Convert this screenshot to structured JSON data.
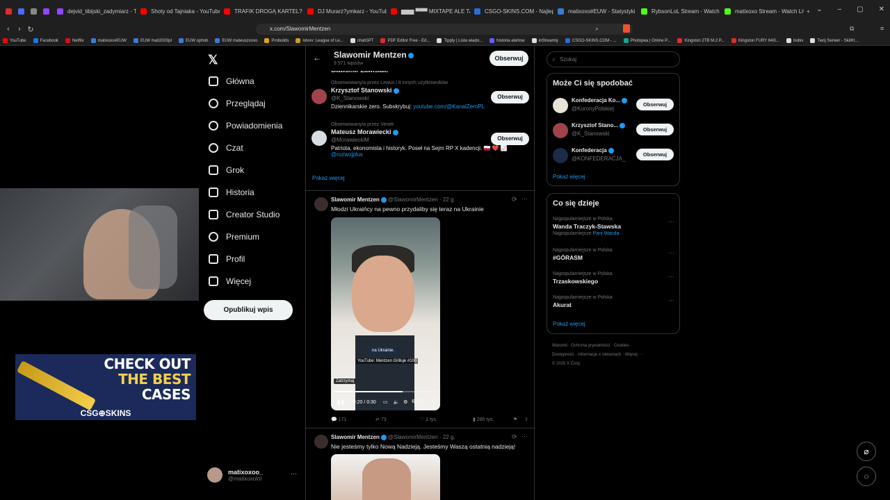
{
  "browser": {
    "tabs": [
      {
        "label": "",
        "color": "#e02b2b"
      },
      {
        "label": "",
        "color": "#4b6bfb"
      },
      {
        "label": "",
        "color": "#888888"
      },
      {
        "label": "",
        "color": "#9146ff"
      },
      {
        "label": "dejvid_tibijski_zadymiarz - Twitch",
        "color": "#9146ff"
      },
      {
        "label": "Shoty od Tajniaka - YouTube",
        "color": "#ff0000"
      },
      {
        "label": "TRAFIK DROGĄ KARTEL? | POWRÓT ...",
        "color": "#ff0000"
      },
      {
        "label": "DJ Murarz?ymkarz - YouTube",
        "color": "#ff0000"
      },
      {
        "label": "▆▆▆ ▀▀▀ MIXTAPE ALE TAJN...",
        "color": "#ff0000"
      },
      {
        "label": "CSGO-SKINS.COM - Najlepsze Skrz...",
        "color": "#2b6cde"
      },
      {
        "label": "matixoxo#EUW - Statystyki przyw...",
        "color": "#3b7bd8"
      },
      {
        "label": "RybsonLoL Stream - Watch Live on ...",
        "color": "#53fc18"
      },
      {
        "label": "matixoxo Stream - Watch Live on ...",
        "color": "#53fc18"
      }
    ],
    "url": "x.com/SlawomirMentzen",
    "bookmarks": [
      {
        "label": "YouTube",
        "color": "#ff0000"
      },
      {
        "label": "Facebook",
        "color": "#1877f2"
      },
      {
        "label": "Netflix",
        "color": "#e50914"
      },
      {
        "label": "matixoxo#EUW",
        "color": "#3b7bd8"
      },
      {
        "label": "EUW mati2003pl",
        "color": "#3b7bd8"
      },
      {
        "label": "EUW ophob",
        "color": "#3b7bd8"
      },
      {
        "label": "EUW mateuszxoxo",
        "color": "#3b7bd8"
      },
      {
        "label": "Probuilds",
        "color": "#e0a020"
      },
      {
        "label": "lolvvv: League of Le...",
        "color": "#c8a020"
      },
      {
        "label": "chatGPT",
        "color": "#dddddd"
      },
      {
        "label": "PDF Editor Free - Ed...",
        "color": "#e02b2b"
      },
      {
        "label": "Tipply | Lista wiado...",
        "color": "#dddddd"
      },
      {
        "label": "historia alertow",
        "color": "#6a5cff"
      },
      {
        "label": "inStreamly",
        "color": "#dddddd"
      },
      {
        "label": "CSGO-SKINS.COM - ...",
        "color": "#2b6cde"
      },
      {
        "label": "Photopea | Online P...",
        "color": "#18a497"
      },
      {
        "label": "Kingston 2TB M.2 P...",
        "color": "#e02b2b"
      },
      {
        "label": "Kingston FURY 64G...",
        "color": "#e02b2b"
      },
      {
        "label": "bobix",
        "color": "#dddddd"
      },
      {
        "label": "Twój Serwer - SkillH...",
        "color": "#dddddd"
      }
    ]
  },
  "nav": {
    "items": [
      {
        "label": "Główna",
        "icon": "home-icon"
      },
      {
        "label": "Przeglądaj",
        "icon": "search-icon"
      },
      {
        "label": "Powiadomienia",
        "icon": "bell-icon"
      },
      {
        "label": "Czat",
        "icon": "chat-icon"
      },
      {
        "label": "Grok",
        "icon": "grok-icon"
      },
      {
        "label": "Historia",
        "icon": "bookmark-icon"
      },
      {
        "label": "Creator Studio",
        "icon": "rocket-icon"
      },
      {
        "label": "Premium",
        "icon": "premium-icon"
      },
      {
        "label": "Profil",
        "icon": "person-icon"
      },
      {
        "label": "Więcej",
        "icon": "more-icon"
      }
    ],
    "post_button": "Opublikuj wpis",
    "account": {
      "name": "matixoxoo_",
      "handle": "@matixoxolol"
    }
  },
  "ad": {
    "lines": [
      "CHECK OUT",
      "THE BEST",
      "CASES"
    ],
    "brand": "CSG⊕SKINS"
  },
  "profile_header": {
    "name": "Slawomir Mentzen",
    "posts": "9 971 wpisów",
    "follow": "Obserwuj",
    "bio_tail": "Slawomir Zawisiak."
  },
  "suggested": [
    {
      "context": "Obserwowany/a przez Lewus i 8 innych użytkowników",
      "name": "Krzysztof Stanowski",
      "handle": "@K_Stanowski",
      "bio": "Dziennikarskie zero. Subskrybuj: ",
      "bio_link": "youtube.com/@KanalZeroPL",
      "follow": "Obserwuj"
    },
    {
      "context": "Obserwowany/a przez Venek",
      "name": "Mateusz Morawiecki",
      "handle": "@MorawieckiM",
      "bio": "Patriota, ekonomista i historyk. Poseł na Sejm RP X kadencji. 🇵🇱 ❤️ 📈",
      "bio_link": "@rozwojplus",
      "follow": "Obserwuj"
    }
  ],
  "show_more": "Pokaż więcej",
  "posts": [
    {
      "name": "Slawomir Mentzen",
      "handle": "@SlawomirMentzen",
      "time": "· 22 g.",
      "text": "Młodzi Ukraińcy na pewno przydaliby się teraz na Ukrainie",
      "video": {
        "caption": "na Ukrainie.",
        "subtitle": "YouTube: Mentzen Grilluje #100",
        "tooltip": "Zatrzymaj",
        "time": "0:20 / 0:30",
        "progress": 0.667
      },
      "replies": "171",
      "reposts": "73",
      "likes": "1 tys.",
      "views": "280 tys."
    },
    {
      "name": "Slawomir Mentzen",
      "handle": "@SlawomirMentzen",
      "time": "· 22 g.",
      "text": "Nie jesteśmy tylko Nową Nadzieją. Jesteśmy Waszą ostatnią nadzieją!"
    }
  ],
  "right": {
    "search_placeholder": "Szukaj",
    "who_to_follow_title": "Może Ci się spodobać",
    "who_to_follow": [
      {
        "name": "Konfederacja Ko...",
        "handle": "@KoronyPolskiej",
        "follow": "Obserwuj"
      },
      {
        "name": "Krzysztof Stano...",
        "handle": "@K_Stanowski",
        "follow": "Obserwuj"
      },
      {
        "name": "Konfederacja",
        "handle": "@KONFEDERACJA_",
        "follow": "Obserwuj"
      }
    ],
    "show_more": "Pokaż więcej",
    "trends_title": "Co się dzieje",
    "trends": [
      {
        "context": "Najpopularniejsze w Polska",
        "topic": "Wanda Traczyk-Stawska",
        "extra_prefix": "Najpopularniejsze ",
        "extra_link": "Pani Wanda"
      },
      {
        "context": "Najpopularniejsze w Polska",
        "topic": "#GÓRASM"
      },
      {
        "context": "Najpopularniejsze w Polska",
        "topic": "Trzaskowskiego"
      },
      {
        "context": "Najpopularniejsze w Polska",
        "topic": "Akurat"
      }
    ],
    "trends_more": "Pokaż więcej",
    "footer": {
      "line1": [
        "Warunki",
        "Ochrona prywatności",
        "Cookies"
      ],
      "line2": [
        "Dostępność",
        "Informacje o reklamach",
        "Więcej ···"
      ],
      "copyright": "© 2025 X Corp."
    }
  }
}
